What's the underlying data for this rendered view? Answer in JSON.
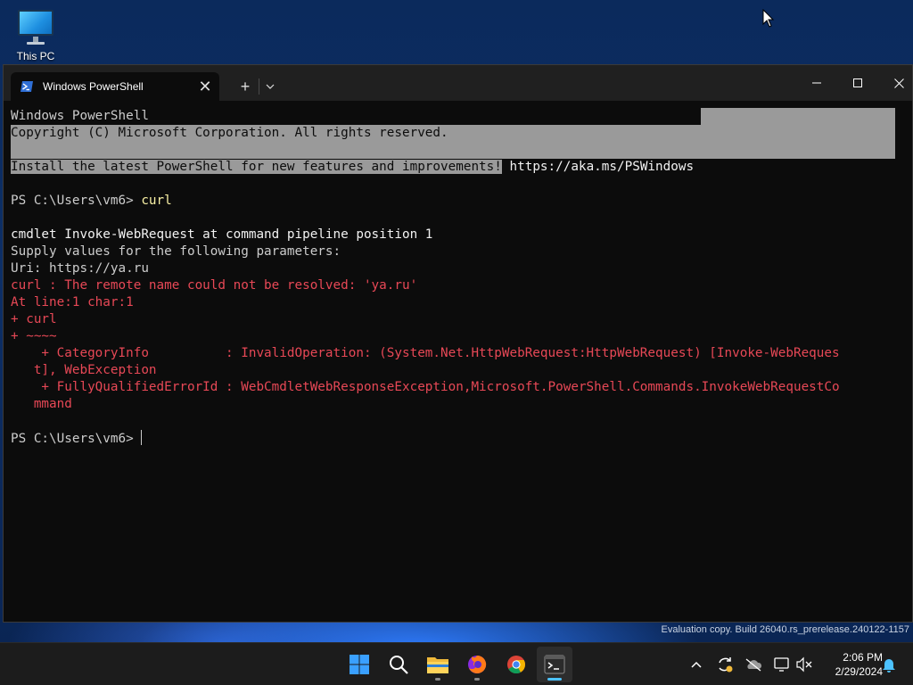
{
  "desktop": {
    "icons": [
      {
        "label": "This PC",
        "icon": "this-pc-icon"
      }
    ]
  },
  "window": {
    "tab_title": "Windows PowerShell",
    "tab_icon": "powershell-icon",
    "new_tab_label": "+",
    "close_tab_label": "✕"
  },
  "console": {
    "lines": [
      {
        "text": "Windows PowerShell",
        "style": "normal"
      },
      {
        "text": "Copyright (C) Microsoft Corporation. All rights reserved.",
        "style": "selected"
      },
      {
        "text": "",
        "style": "selected"
      },
      {
        "text": "Install the latest PowerShell for new features and improvements!",
        "style": "selected",
        "suffix": " https://aka.ms/PSWindows"
      },
      {
        "text": "",
        "style": "normal"
      },
      {
        "text": "PS C:\\Users\\vm6> ",
        "style": "normal",
        "command": "curl"
      },
      {
        "text": "",
        "style": "normal"
      },
      {
        "text": "cmdlet Invoke-WebRequest at command pipeline position 1",
        "style": "white"
      },
      {
        "text": "Supply values for the following parameters:",
        "style": "normal"
      },
      {
        "text": "Uri: https://ya.ru",
        "style": "normal"
      },
      {
        "text": "curl : The remote name could not be resolved: 'ya.ru'",
        "style": "error"
      },
      {
        "text": "At line:1 char:1",
        "style": "error"
      },
      {
        "text": "+ curl",
        "style": "error"
      },
      {
        "text": "+ ~~~~",
        "style": "error"
      },
      {
        "text": "    + CategoryInfo          : InvalidOperation: (System.Net.HttpWebRequest:HttpWebRequest) [Invoke-WebReques",
        "style": "error"
      },
      {
        "text": "   t], WebException",
        "style": "error"
      },
      {
        "text": "    + FullyQualifiedErrorId : WebCmdletWebResponseException,Microsoft.PowerShell.Commands.InvokeWebRequestCo",
        "style": "error"
      },
      {
        "text": "   mmand",
        "style": "error"
      },
      {
        "text": "",
        "style": "normal"
      },
      {
        "text": "PS C:\\Users\\vm6> ",
        "style": "normal",
        "cursor": true
      }
    ]
  },
  "watermark": "Evaluation copy. Build 26040.rs_prerelease.240122-1157",
  "taskbar": {
    "apps": [
      {
        "name": "start",
        "icon": "windows-start-icon"
      },
      {
        "name": "search",
        "icon": "search-icon"
      },
      {
        "name": "file-explorer",
        "icon": "folder-icon"
      },
      {
        "name": "firefox",
        "icon": "firefox-icon"
      },
      {
        "name": "chrome",
        "icon": "chrome-icon"
      },
      {
        "name": "terminal",
        "icon": "terminal-icon",
        "active": true
      }
    ],
    "tray": [
      "chevron-up-icon",
      "sync-icon",
      "cloud-off-icon",
      "network-icon",
      "volume-muted-icon"
    ],
    "clock": {
      "time": "2:06 PM",
      "date": "2/29/2024"
    },
    "notification_icon": "bell-icon"
  },
  "colors": {
    "console_bg": "#0c0c0c",
    "console_fg": "#cccccc",
    "error": "#e74856",
    "selection": "#9a9a9a",
    "accent": "#4cc2ff"
  }
}
